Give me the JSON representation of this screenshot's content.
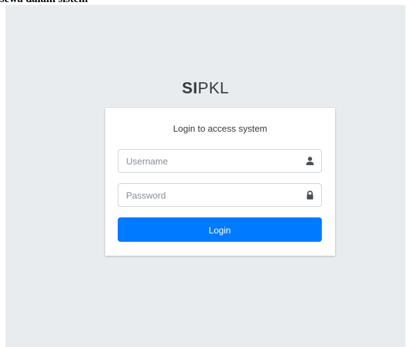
{
  "top_clipped_text": "sewa dalam sistem",
  "brand": {
    "strong": "SI",
    "light": "PKL"
  },
  "login": {
    "message": "Login to access system",
    "username_placeholder": "Username",
    "password_placeholder": "Password",
    "button_label": "Login",
    "username_icon": "user-icon",
    "password_icon": "lock-icon"
  },
  "colors": {
    "page_background": "#e9ecef",
    "primary": "#007bff",
    "card_background": "#ffffff"
  }
}
